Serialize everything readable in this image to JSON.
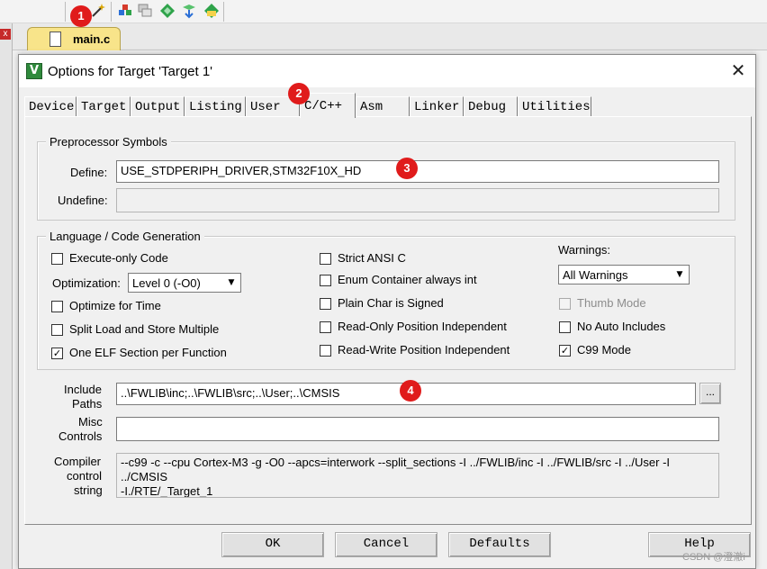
{
  "colors": {
    "badge": "#e01b1b",
    "file_tab": "#f8e48a",
    "app_icon": "#2f8a3c"
  },
  "toolbar": {
    "icons": [
      "magic-wand-icon",
      "component-icon",
      "stack-icon",
      "diamond-icon",
      "pack-install-icon",
      "pack-manager-icon"
    ]
  },
  "left_pane": {
    "close_glyph": "x"
  },
  "editor": {
    "file_tab_label": "main.c"
  },
  "dialog": {
    "title": "Options for Target 'Target 1'",
    "app_icon_glyph": "V",
    "close_glyph": "✕",
    "tabs": [
      {
        "label": "Device",
        "active": false
      },
      {
        "label": "Target",
        "active": false
      },
      {
        "label": "Output",
        "active": false
      },
      {
        "label": "Listing",
        "active": false
      },
      {
        "label": "User",
        "active": false
      },
      {
        "label": "C/C++",
        "active": true
      },
      {
        "label": "Asm",
        "active": false
      },
      {
        "label": "Linker",
        "active": false
      },
      {
        "label": "Debug",
        "active": false
      },
      {
        "label": "Utilities",
        "active": false
      }
    ],
    "preprocessor": {
      "title": "Preprocessor Symbols",
      "define_label": "Define:",
      "define_value": "USE_STDPERIPH_DRIVER,STM32F10X_HD",
      "undefine_label": "Undefine:",
      "undefine_value": ""
    },
    "language": {
      "title": "Language / Code Generation",
      "execute_only": {
        "label": "Execute-only Code",
        "checked": false
      },
      "optimization_label": "Optimization:",
      "optimization_value": "Level 0 (-O0)",
      "optimize_time": {
        "label": "Optimize for Time",
        "checked": false
      },
      "split_load": {
        "label": "Split Load and Store Multiple",
        "checked": false
      },
      "one_elf": {
        "label": "One ELF Section per Function",
        "checked": true
      },
      "strict_ansi": {
        "label": "Strict ANSI C",
        "checked": false
      },
      "enum_container": {
        "label": "Enum Container always int",
        "checked": false
      },
      "plain_char": {
        "label": "Plain Char is Signed",
        "checked": false
      },
      "ro_position": {
        "label": "Read-Only Position Independent",
        "checked": false
      },
      "rw_position": {
        "label": "Read-Write Position Independent",
        "checked": false
      },
      "warnings_label": "Warnings:",
      "warnings_value": "All Warnings",
      "thumb_mode": {
        "label": "Thumb Mode",
        "checked": false,
        "disabled": true
      },
      "no_auto_includes": {
        "label": "No Auto Includes",
        "checked": false
      },
      "c99_mode": {
        "label": "C99 Mode",
        "checked": true
      }
    },
    "include_paths": {
      "label_line1": "Include",
      "label_line2": "Paths",
      "value": "..\\FWLIB\\inc;..\\FWLIB\\src;..\\User;..\\CMSIS",
      "browse_label": "..."
    },
    "misc_controls": {
      "label_line1": "Misc",
      "label_line2": "Controls",
      "value": ""
    },
    "compiler_control": {
      "label_line1": "Compiler",
      "label_line2": "control",
      "label_line3": "string",
      "value": "--c99 -c --cpu Cortex-M3 -g -O0 --apcs=interwork --split_sections -I ../FWLIB/inc -I ../FWLIB/src -I ../User -I ../CMSIS\n-I./RTE/_Target_1"
    },
    "buttons": {
      "ok": "OK",
      "cancel": "Cancel",
      "defaults": "Defaults",
      "help": "Help"
    }
  },
  "badges": [
    "1",
    "2",
    "3",
    "4"
  ],
  "watermark": "CSDN @澄澈i"
}
